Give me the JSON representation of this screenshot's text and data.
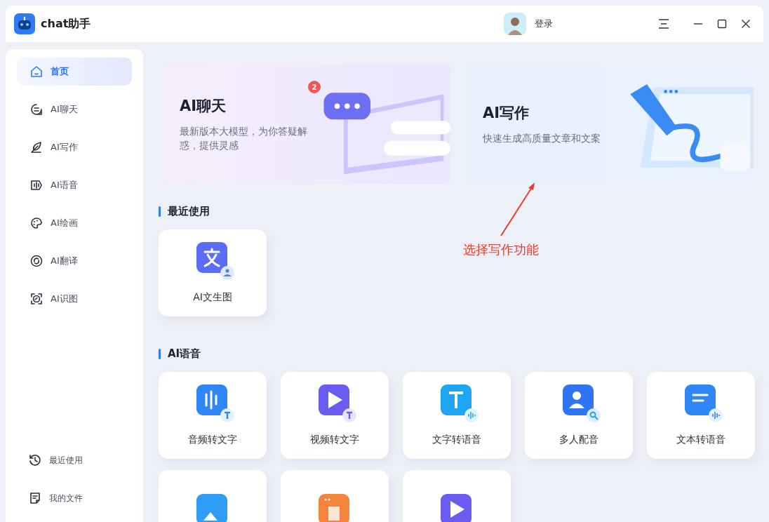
{
  "window": {
    "title": "chat助手",
    "login": "登录"
  },
  "sidebar": {
    "items": [
      {
        "label": "首页",
        "kind": "home",
        "selected": true
      },
      {
        "label": "AI聊天",
        "kind": "chat",
        "selected": false
      },
      {
        "label": "AI写作",
        "kind": "feather",
        "selected": false
      },
      {
        "label": "AI语音",
        "kind": "voice",
        "selected": false
      },
      {
        "label": "AI绘画",
        "kind": "palette",
        "selected": false
      },
      {
        "label": "AI翻译",
        "kind": "translate",
        "selected": false
      },
      {
        "label": "AI识图",
        "kind": "scan",
        "selected": false
      }
    ],
    "footer": [
      {
        "label": "最近使用",
        "kind": "history"
      },
      {
        "label": "我的文件",
        "kind": "file"
      }
    ]
  },
  "banners": [
    {
      "kind": "chat",
      "title": "AI聊天",
      "description": "最新版本大模型，为你答疑解惑，提供灵感",
      "badge": "2"
    },
    {
      "kind": "write",
      "title": "AI写作",
      "description": "快速生成高质量文章和文案"
    }
  ],
  "annotation": {
    "text": "选择写作功能"
  },
  "sections": [
    {
      "title": "最近使用",
      "tools": [
        {
          "label": "AI文生图",
          "kind": "text-image",
          "color": "#5b6cf6"
        }
      ]
    },
    {
      "title": "AI语音",
      "tools": [
        {
          "label": "音频转文字",
          "kind": "audio-text",
          "color": "#2f86f6"
        },
        {
          "label": "视频转文字",
          "kind": "video-text",
          "color": "#6a5cf0"
        },
        {
          "label": "文字转语音",
          "kind": "text-audio",
          "color": "#1ea6f5"
        },
        {
          "label": "多人配音",
          "kind": "people",
          "color": "#2f74f2"
        },
        {
          "label": "文本转语音",
          "kind": "doc-audio",
          "color": "#2f86f6"
        },
        {
          "kind": "image",
          "color": "#2f9cf6"
        },
        {
          "kind": "window",
          "color": "#f5843c"
        },
        {
          "kind": "video",
          "color": "#6a5cf0"
        }
      ]
    }
  ]
}
